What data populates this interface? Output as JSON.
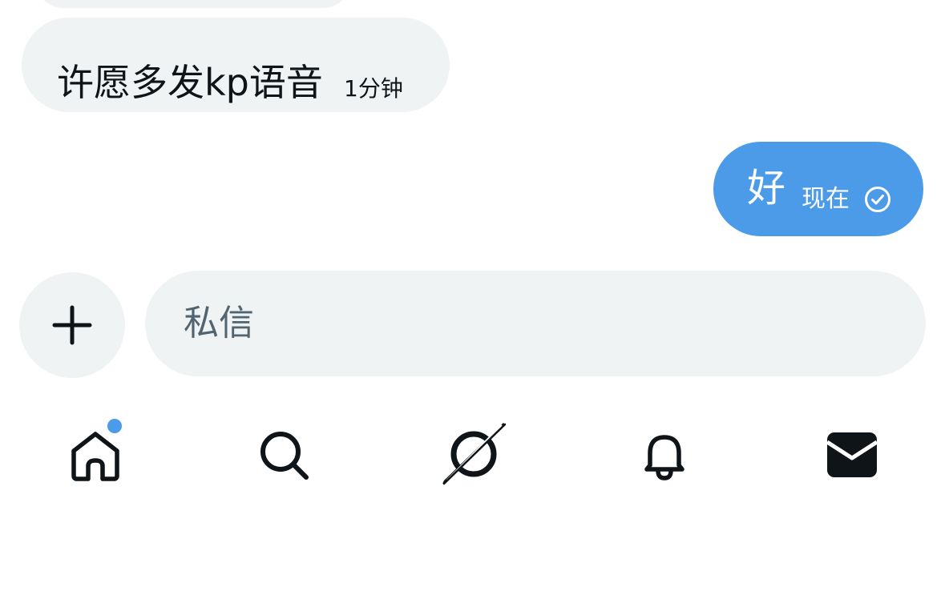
{
  "conversation": {
    "messages": [
      {
        "direction": "incoming",
        "text": "许愿多发kp语音",
        "time": "1分钟"
      },
      {
        "direction": "outgoing",
        "text": "好",
        "time": "现在",
        "status_icon": "read-check-icon"
      }
    ]
  },
  "composer": {
    "add_icon": "plus-icon",
    "placeholder": "私信",
    "value": ""
  },
  "bottom_nav": {
    "items": [
      {
        "icon": "home-icon",
        "has_badge": true,
        "active": false
      },
      {
        "icon": "search-icon",
        "has_badge": false,
        "active": false
      },
      {
        "icon": "grok-icon",
        "has_badge": false,
        "active": false
      },
      {
        "icon": "bell-icon",
        "has_badge": false,
        "active": false
      },
      {
        "icon": "mail-icon",
        "has_badge": false,
        "active": true
      }
    ]
  },
  "colors": {
    "accent": "#4c9be8",
    "bubble_gray": "#eff3f4",
    "text": "#0f1419",
    "placeholder": "#536471"
  }
}
